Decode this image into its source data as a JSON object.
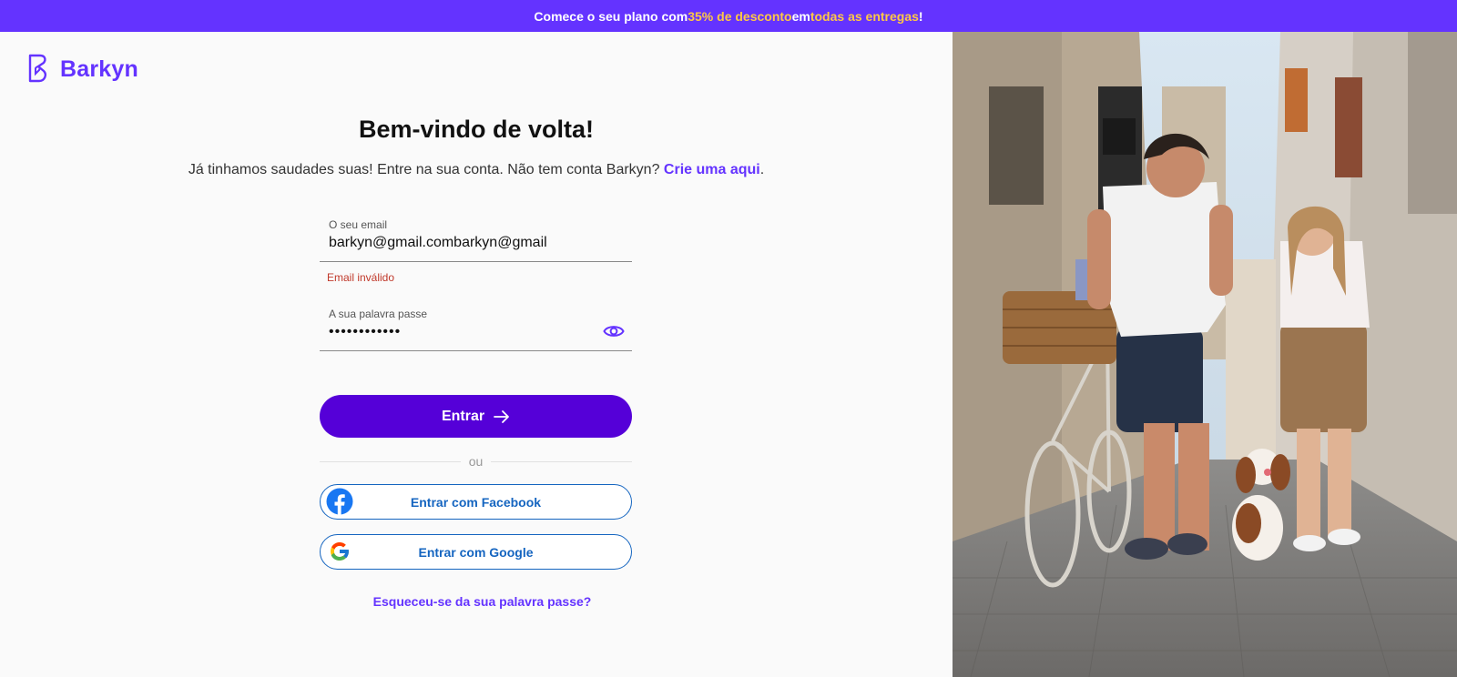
{
  "promo": {
    "prefix": "Comece o seu plano com ",
    "discount": "35% de desconto",
    "middle": " em ",
    "deliveries": "todas as entregas",
    "suffix": "!"
  },
  "logo": {
    "text": "Barkyn"
  },
  "login": {
    "title": "Bem-vindo de volta!",
    "subtitle": "Já tinhamos saudades suas! Entre na sua conta. Não tem conta Barkyn? ",
    "signup_link": "Crie uma aqui",
    "signup_suffix": ".",
    "email_label": "O seu email",
    "email_value": "barkyn@gmail.combarkyn@gmail",
    "email_error": "Email inválido",
    "password_label": "A sua palavra passe",
    "password_value": "••••••••••••",
    "submit_label": "Entrar",
    "divider": "ou",
    "facebook_label": "Entrar com Facebook",
    "google_label": "Entrar com Google",
    "forgot_label": "Esqueceu-se da sua palavra passe?"
  },
  "icons": {
    "eye": "eye-icon",
    "arrow": "arrow-right-icon",
    "facebook": "facebook-icon",
    "google": "google-icon"
  },
  "colors": {
    "brand": "#6433ff",
    "button": "#5500d8",
    "highlight": "#ffc845",
    "error": "#c0392b",
    "social": "#1565c0"
  }
}
